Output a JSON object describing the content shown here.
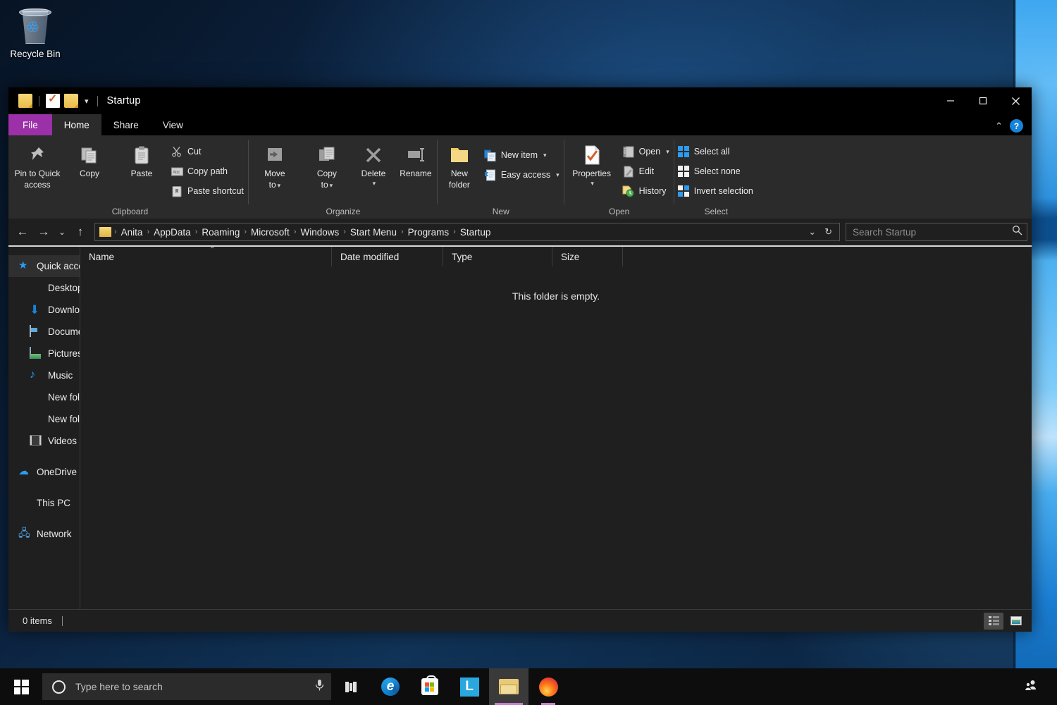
{
  "desktop": {
    "icons": [
      {
        "name": "recycle-bin",
        "label": "Recycle Bin"
      }
    ]
  },
  "window": {
    "title": "Startup",
    "quick_access": [
      {
        "name": "folder-icon"
      },
      {
        "name": "properties-icon"
      },
      {
        "name": "new-folder-icon"
      },
      {
        "name": "customize-caret-icon",
        "glyph": "▾"
      }
    ],
    "controls": {
      "minimize": "Minimize",
      "maximize": "Maximize",
      "close": "Close"
    },
    "ribbon_collapse_glyph": "⌃",
    "help_glyph": "?"
  },
  "ribbon": {
    "tabs": [
      {
        "label": "File",
        "kind": "file"
      },
      {
        "label": "Home",
        "kind": "active"
      },
      {
        "label": "Share",
        "kind": "normal"
      },
      {
        "label": "View",
        "kind": "normal"
      }
    ],
    "groups": [
      {
        "title": "Clipboard",
        "big": [
          {
            "label_line1": "Pin to Quick",
            "label_line2": "access",
            "icon": "pin-icon"
          },
          {
            "label_line1": "Copy",
            "label_line2": "",
            "icon": "copy-icon"
          },
          {
            "label_line1": "Paste",
            "label_line2": "",
            "icon": "paste-icon"
          }
        ],
        "small": [
          {
            "label": "Cut",
            "icon": "scissors-icon"
          },
          {
            "label": "Copy path",
            "icon": "copy-path-icon"
          },
          {
            "label": "Paste shortcut",
            "icon": "paste-shortcut-icon"
          }
        ]
      },
      {
        "title": "Organize",
        "big": [
          {
            "label_line1": "Move",
            "label_line2": "to",
            "icon": "move-to-icon",
            "caret": "▾"
          },
          {
            "label_line1": "Copy",
            "label_line2": "to",
            "icon": "copy-to-icon",
            "caret": "▾"
          },
          {
            "label_line1": "Delete",
            "label_line2": "",
            "icon": "delete-icon",
            "caret": "▾"
          },
          {
            "label_line1": "Rename",
            "label_line2": "",
            "icon": "rename-icon"
          }
        ],
        "small": []
      },
      {
        "title": "New",
        "big": [
          {
            "label_line1": "New",
            "label_line2": "folder",
            "icon": "new-folder-icon"
          }
        ],
        "small": [
          {
            "label": "New item",
            "icon": "new-item-icon",
            "caret": "▾"
          },
          {
            "label": "Easy access",
            "icon": "easy-access-icon",
            "caret": "▾"
          }
        ]
      },
      {
        "title": "Open",
        "big": [
          {
            "label_line1": "Properties",
            "label_line2": "",
            "icon": "properties-icon",
            "caret": "▾"
          }
        ],
        "small": [
          {
            "label": "Open",
            "icon": "open-icon",
            "caret": "▾"
          },
          {
            "label": "Edit",
            "icon": "edit-icon"
          },
          {
            "label": "History",
            "icon": "history-icon"
          }
        ]
      },
      {
        "title": "Select",
        "big": [],
        "small": [
          {
            "label": "Select all",
            "icon": "select-all-icon"
          },
          {
            "label": "Select none",
            "icon": "select-none-icon"
          },
          {
            "label": "Invert selection",
            "icon": "invert-selection-icon"
          }
        ]
      }
    ]
  },
  "address": {
    "back_glyph": "←",
    "forward_glyph": "→",
    "recent_glyph": "⌄",
    "up_glyph": "↑",
    "breadcrumbs": [
      "Anita",
      "AppData",
      "Roaming",
      "Microsoft",
      "Windows",
      "Start Menu",
      "Programs",
      "Startup"
    ],
    "separator": "›",
    "dropdown_glyph": "⌄",
    "refresh_glyph": "↻"
  },
  "search": {
    "placeholder": "Search Startup",
    "value": "",
    "icon": "search-icon"
  },
  "navpane": {
    "items": [
      {
        "label": "Quick access",
        "icon": "quick-access-star-icon",
        "selected": true,
        "root": true,
        "pinned": false
      },
      {
        "label": "Desktop",
        "icon": "desktop-icon",
        "selected": false,
        "root": false,
        "pinned": true
      },
      {
        "label": "Downloads",
        "icon": "downloads-icon",
        "selected": false,
        "root": false,
        "pinned": true
      },
      {
        "label": "Documents",
        "icon": "documents-icon",
        "selected": false,
        "root": false,
        "pinned": true
      },
      {
        "label": "Pictures",
        "icon": "pictures-icon",
        "selected": false,
        "root": false,
        "pinned": true
      },
      {
        "label": "Music",
        "icon": "music-icon",
        "selected": false,
        "root": false,
        "pinned": false
      },
      {
        "label": "New folder",
        "icon": "folder-icon",
        "selected": false,
        "root": false,
        "pinned": false
      },
      {
        "label": "New folder",
        "icon": "folder-icon",
        "selected": false,
        "root": false,
        "pinned": false
      },
      {
        "label": "Videos",
        "icon": "videos-icon",
        "selected": false,
        "root": false,
        "pinned": false
      }
    ],
    "roots": [
      {
        "label": "OneDrive",
        "icon": "onedrive-cloud-icon"
      },
      {
        "label": "This PC",
        "icon": "this-pc-icon"
      },
      {
        "label": "Network",
        "icon": "network-icon"
      }
    ]
  },
  "filelist": {
    "columns": [
      {
        "label": "Name",
        "sorted": true,
        "sort_glyph": "⌃"
      },
      {
        "label": "Date modified",
        "sorted": false
      },
      {
        "label": "Type",
        "sorted": false
      },
      {
        "label": "Size",
        "sorted": false
      }
    ],
    "rows": [],
    "empty_message": "This folder is empty."
  },
  "statusbar": {
    "item_count": "0 items",
    "views": [
      {
        "name": "details-view",
        "active": true
      },
      {
        "name": "large-icons-view",
        "active": false
      }
    ]
  },
  "taskbar": {
    "start": "Start",
    "search_placeholder": "Type here to search",
    "cortana": "cortana-icon",
    "mic_glyph": "🎤",
    "task_view": "Task view",
    "apps": [
      {
        "name": "microsoft-edge",
        "label": "e",
        "running": false
      },
      {
        "name": "microsoft-store",
        "label": "",
        "running": false
      },
      {
        "name": "app-l",
        "label": "L",
        "running": false
      },
      {
        "name": "file-explorer",
        "label": "",
        "running": true
      },
      {
        "name": "firefox",
        "label": "",
        "running": false
      }
    ],
    "people_glyph": "people-icon"
  }
}
